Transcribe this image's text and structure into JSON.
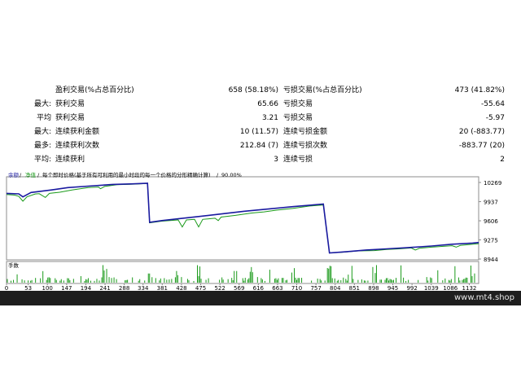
{
  "stats": {
    "rows": [
      {
        "prefix": "",
        "label1": "盈利交易(%占总百分比)",
        "val1": "658 (58.18%)",
        "label2": "亏损交易(%占总百分比)",
        "val2": "473 (41.82%)"
      },
      {
        "prefix": "最大:",
        "label1": "获利交易",
        "val1": "65.66",
        "label2": "亏损交易",
        "val2": "-55.64"
      },
      {
        "prefix": "平均",
        "label1": "获利交易",
        "val1": "3.21",
        "label2": "亏损交易",
        "val2": "-5.97"
      },
      {
        "prefix": "最大:",
        "label1": "连续获利金额",
        "val1": "10 (11.57)",
        "label2": "连续亏损金额",
        "val2": "20 (-883.77)"
      },
      {
        "prefix": "最多:",
        "label1": "连续获利次数",
        "val1": "212.84 (7)",
        "label2": "连续亏损次数",
        "val2": "-883.77 (20)"
      },
      {
        "prefix": "平均:",
        "label1": "连续获利",
        "val1": "3",
        "label2": "连续亏损",
        "val2": "2"
      }
    ]
  },
  "chart_data": {
    "type": "line",
    "legend": {
      "balance": "余额",
      "equity": "净值",
      "description": "每个即时价格(基于所有可利用的最小时段的每一个价格的分形精确计算)",
      "quality": "90.00%"
    },
    "y_ticks": [
      "10269",
      "9937",
      "9606",
      "9275",
      "8944"
    ],
    "ylim": [
      8944,
      10269
    ],
    "x_ticks": [
      "0",
      "53",
      "100",
      "147",
      "194",
      "241",
      "288",
      "334",
      "381",
      "428",
      "475",
      "522",
      "569",
      "616",
      "663",
      "710",
      "757",
      "804",
      "851",
      "898",
      "945",
      "992",
      "1039",
      "1086",
      "1132"
    ],
    "xlim": [
      0,
      1155
    ],
    "volume_label": "手数",
    "balance": [
      [
        0,
        10080
      ],
      [
        30,
        10072
      ],
      [
        40,
        10020
      ],
      [
        60,
        10095
      ],
      [
        110,
        10140
      ],
      [
        150,
        10180
      ],
      [
        200,
        10205
      ],
      [
        260,
        10235
      ],
      [
        310,
        10245
      ],
      [
        345,
        10255
      ],
      [
        350,
        9580
      ],
      [
        380,
        9610
      ],
      [
        420,
        9640
      ],
      [
        470,
        9680
      ],
      [
        520,
        9720
      ],
      [
        580,
        9770
      ],
      [
        640,
        9810
      ],
      [
        700,
        9850
      ],
      [
        750,
        9880
      ],
      [
        775,
        9895
      ],
      [
        790,
        9050
      ],
      [
        830,
        9070
      ],
      [
        880,
        9100
      ],
      [
        930,
        9120
      ],
      [
        980,
        9140
      ],
      [
        1040,
        9170
      ],
      [
        1090,
        9200
      ],
      [
        1140,
        9220
      ],
      [
        1155,
        9230
      ]
    ],
    "equity": [
      [
        0,
        10060
      ],
      [
        20,
        10050
      ],
      [
        30,
        10030
      ],
      [
        40,
        9945
      ],
      [
        50,
        10020
      ],
      [
        70,
        10070
      ],
      [
        80,
        10075
      ],
      [
        95,
        10010
      ],
      [
        105,
        10080
      ],
      [
        130,
        10100
      ],
      [
        160,
        10140
      ],
      [
        200,
        10180
      ],
      [
        225,
        10190
      ],
      [
        230,
        10160
      ],
      [
        240,
        10200
      ],
      [
        270,
        10230
      ],
      [
        310,
        10240
      ],
      [
        345,
        10250
      ],
      [
        350,
        9570
      ],
      [
        380,
        9600
      ],
      [
        420,
        9620
      ],
      [
        430,
        9500
      ],
      [
        440,
        9620
      ],
      [
        460,
        9630
      ],
      [
        470,
        9500
      ],
      [
        480,
        9630
      ],
      [
        510,
        9650
      ],
      [
        518,
        9610
      ],
      [
        525,
        9670
      ],
      [
        560,
        9700
      ],
      [
        600,
        9740
      ],
      [
        630,
        9760
      ],
      [
        660,
        9790
      ],
      [
        700,
        9820
      ],
      [
        740,
        9860
      ],
      [
        775,
        9880
      ],
      [
        790,
        9050
      ],
      [
        820,
        9060
      ],
      [
        860,
        9085
      ],
      [
        900,
        9090
      ],
      [
        930,
        9110
      ],
      [
        960,
        9120
      ],
      [
        990,
        9135
      ],
      [
        1000,
        9100
      ],
      [
        1010,
        9130
      ],
      [
        1040,
        9150
      ],
      [
        1090,
        9175
      ],
      [
        1100,
        9150
      ],
      [
        1110,
        9180
      ],
      [
        1155,
        9210
      ]
    ]
  },
  "footer": {
    "site": "www.mt4.shop"
  }
}
